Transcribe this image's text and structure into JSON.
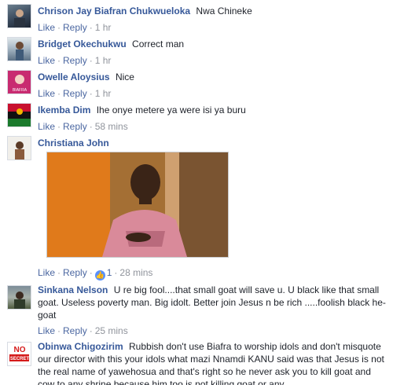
{
  "labels": {
    "like": "Like",
    "reply": "Reply",
    "separator": "·"
  },
  "comments": [
    {
      "author": "Chrison Jay Biafran Chukwueloka",
      "text": "Nwa Chineke",
      "time": "1 hr"
    },
    {
      "author": "Bridget Okechukwu",
      "text": "Correct man",
      "time": "1 hr"
    },
    {
      "author": "Owelle Aloysius",
      "text": "Nice",
      "time": "1 hr"
    },
    {
      "author": "Ikemba Dim",
      "text": "Ihe onye metere ya were isi ya buru",
      "time": "58 mins"
    },
    {
      "author": "Christiana John",
      "text": "",
      "time": "",
      "reactions": "1",
      "reaction_time": "28 mins"
    },
    {
      "author": "Sinkana Nelson",
      "text": "U re big fool....that small goat will save u. U black like that small goat. Useless poverty man. Big idolt. Better join Jesus n be rich .....foolish black he-goat",
      "time": "25 mins"
    },
    {
      "author": "Obinwa Chigozirim",
      "text": "Rubbish don't use Biafra to worship idols and don't misquote our director with this your idols what mazi Nnamdi KANU said was that Jesus is not the real name of yawehosua and that's right so he never ask you to kill goat and cow to any shrine because him too is not killing goat or any",
      "time": ""
    }
  ],
  "avatar_art": {
    "owelle": "BIAFRA",
    "obinwa_top": "NO",
    "obinwa_bottom": "SECRET"
  },
  "colors": {
    "link": "#365899",
    "action": "#4b67a1",
    "meta": "#90949c",
    "like_badge": "#5890ff"
  }
}
